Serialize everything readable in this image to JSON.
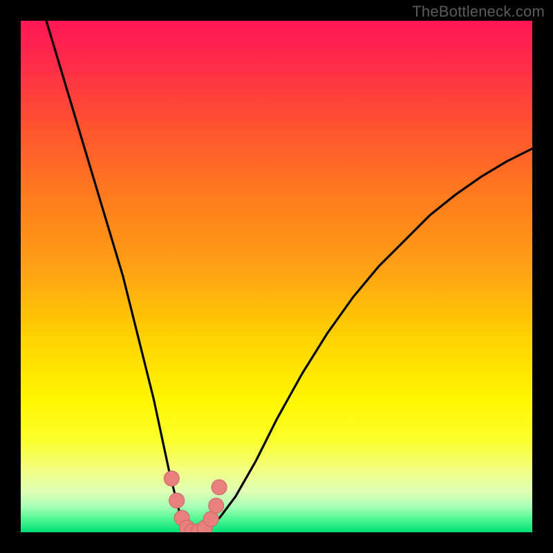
{
  "watermark": "TheBottleneck.com",
  "colors": {
    "frame": "#000000",
    "curve": "#000000",
    "marker_fill": "#e98080",
    "marker_stroke": "#c96464",
    "gradient_stops": [
      {
        "offset": 0.0,
        "color": "#ff1754"
      },
      {
        "offset": 0.08,
        "color": "#ff2a4a"
      },
      {
        "offset": 0.2,
        "color": "#ff5030"
      },
      {
        "offset": 0.34,
        "color": "#ff7a1e"
      },
      {
        "offset": 0.48,
        "color": "#ffa015"
      },
      {
        "offset": 0.62,
        "color": "#ffd200"
      },
      {
        "offset": 0.74,
        "color": "#fff600"
      },
      {
        "offset": 0.82,
        "color": "#fbff2a"
      },
      {
        "offset": 0.88,
        "color": "#f2ff85"
      },
      {
        "offset": 0.92,
        "color": "#dfffb4"
      },
      {
        "offset": 0.95,
        "color": "#a8ffb6"
      },
      {
        "offset": 0.975,
        "color": "#4cf78f"
      },
      {
        "offset": 1.0,
        "color": "#00e077"
      }
    ]
  },
  "chart_data": {
    "type": "line",
    "title": "",
    "xlabel": "",
    "ylabel": "",
    "xlim": [
      0,
      100
    ],
    "ylim": [
      0,
      100
    ],
    "series": [
      {
        "name": "bottleneck-curve",
        "x": [
          5,
          8,
          11,
          14,
          17,
          20,
          22,
          24,
          26,
          27.5,
          29,
          30.5,
          31.5,
          33,
          35,
          37,
          39,
          42,
          46,
          50,
          55,
          60,
          65,
          70,
          75,
          80,
          85,
          90,
          95,
          100
        ],
        "y": [
          100,
          90,
          80,
          70,
          60,
          50,
          42,
          34,
          26,
          19,
          12,
          6,
          2,
          0,
          0,
          1,
          3,
          7,
          14,
          22,
          31,
          39,
          46,
          52,
          57,
          62,
          66,
          69.5,
          72.5,
          75
        ]
      }
    ],
    "markers": {
      "name": "trough-markers",
      "x": [
        29.5,
        30.5,
        31.5,
        32.5,
        33.5,
        34.8,
        36.0,
        37.2,
        38.2,
        38.8
      ],
      "y": [
        10.5,
        6.2,
        2.8,
        0.9,
        0.2,
        0.2,
        0.9,
        2.6,
        5.2,
        8.8
      ]
    },
    "annotations": [
      {
        "text": "TheBottleneck.com",
        "pos": "top-right"
      }
    ]
  }
}
